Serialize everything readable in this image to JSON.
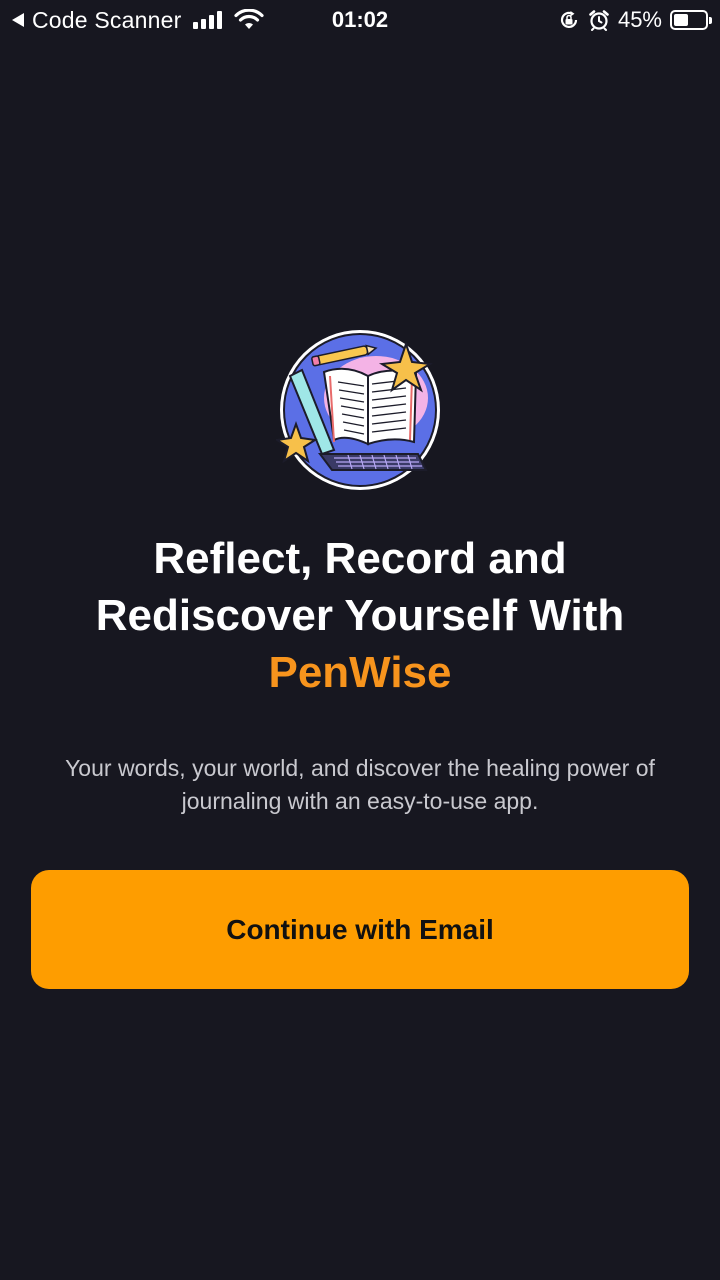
{
  "status_bar": {
    "back_app": "Code Scanner",
    "time": "01:02",
    "battery_percent_label": "45%",
    "battery_level": 0.45
  },
  "welcome": {
    "headline_line1": "Reflect, Record and",
    "headline_line2": "Rediscover Yourself With",
    "brand_name": "PenWise",
    "subtitle": "Your words, your world, and discover the healing power of journaling with an easy-to-use app.",
    "cta_label": "Continue with Email"
  },
  "colors": {
    "background": "#171720",
    "accent": "#fe9d00",
    "brand_text": "#f7941d",
    "text_primary": "#ffffff",
    "text_secondary": "#c9c9cf"
  },
  "icons": {
    "status": [
      "back-arrow-icon",
      "signal-icon",
      "wifi-icon",
      "orientation-lock-icon",
      "alarm-icon",
      "battery-icon"
    ],
    "illustration": "journal-laptop-illustration"
  }
}
